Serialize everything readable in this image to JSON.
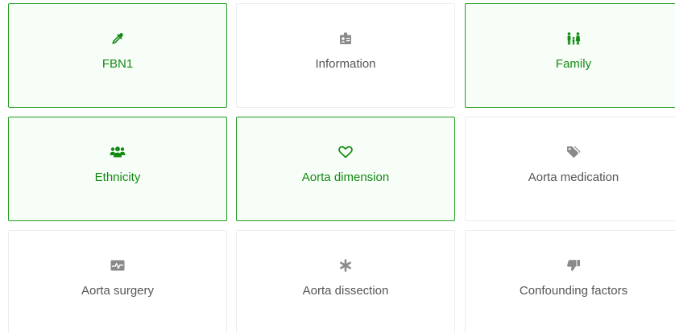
{
  "colors": {
    "selected_border": "#1f9d1f",
    "selected_text": "#138a13",
    "selected_background": "#f7fdf7",
    "unselected_text": "#555555",
    "unselected_icon": "#8a8a8a"
  },
  "cards": [
    {
      "label": "FBN1",
      "icon": "eyedropper-icon",
      "selected": true
    },
    {
      "label": "Information",
      "icon": "id-badge-icon",
      "selected": false
    },
    {
      "label": "Family",
      "icon": "family-icon",
      "selected": true
    },
    {
      "label": "Ethnicity",
      "icon": "users-group-icon",
      "selected": true
    },
    {
      "label": "Aorta dimension",
      "icon": "heart-outline-icon",
      "selected": true
    },
    {
      "label": "Aorta medication",
      "icon": "tag-icon",
      "selected": false
    },
    {
      "label": "Aorta surgery",
      "icon": "heartbeat-monitor-icon",
      "selected": false
    },
    {
      "label": "Aorta dissection",
      "icon": "asterisk-icon",
      "selected": false
    },
    {
      "label": "Confounding factors",
      "icon": "thumbs-down-icon",
      "selected": false
    }
  ]
}
